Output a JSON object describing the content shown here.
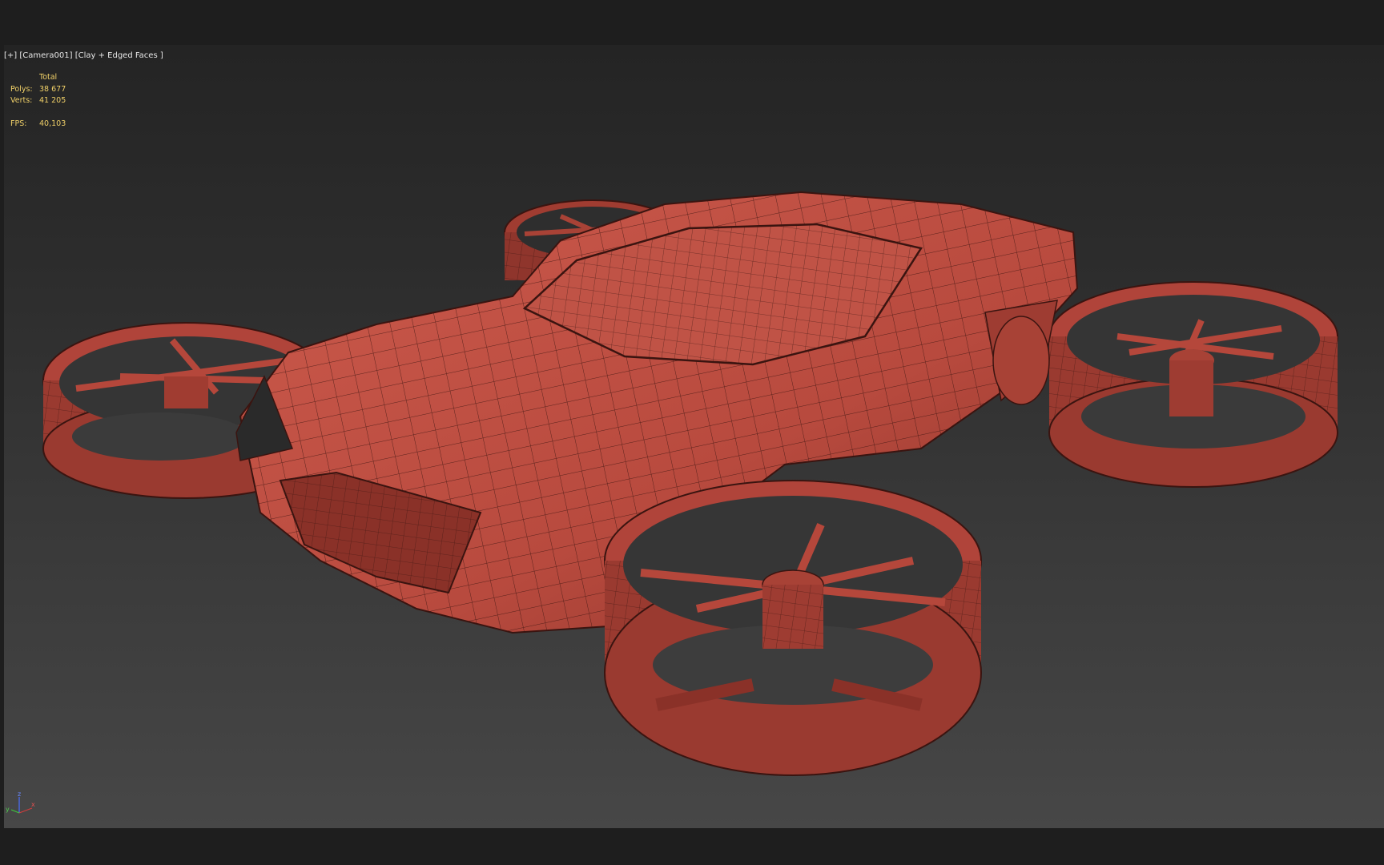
{
  "viewport": {
    "label_plus": "[+]",
    "label_camera": "[Camera001]",
    "label_shading": "[Clay + Edged Faces ]"
  },
  "stats": {
    "header": "Total",
    "polys_label": "Polys:",
    "polys_value": "38 677",
    "verts_label": "Verts:",
    "verts_value": "41 205",
    "fps_label": "FPS:",
    "fps_value": "40,103"
  },
  "axis": {
    "z": "z",
    "x": "x",
    "y": "y"
  },
  "colors": {
    "clay": "#b84a3e",
    "clay_light": "#cc5a4c",
    "clay_dark": "#7a2a22",
    "wire": "#3a1410",
    "stats_text": "#f0d068"
  }
}
